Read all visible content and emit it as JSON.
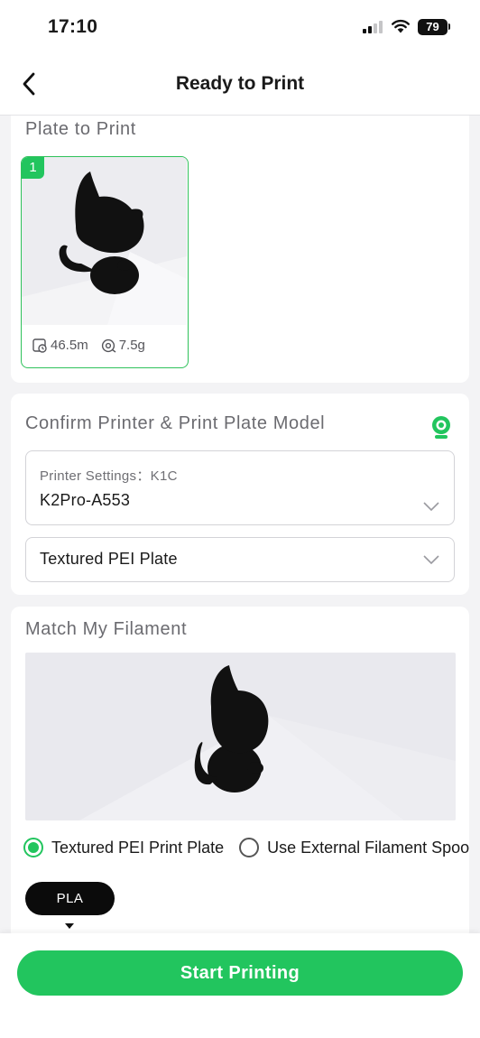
{
  "status_bar": {
    "time": "17:10",
    "battery": "79",
    "signal_bars": 2
  },
  "nav": {
    "title": "Ready to Print",
    "back_icon": "chevron-left-icon"
  },
  "plate_section": {
    "title": "Plate to Print",
    "plates": [
      {
        "number": "1",
        "length": "46.5m",
        "weight": "7.5g",
        "selected": true
      }
    ]
  },
  "printer_section": {
    "title": "Confirm Printer & Print Plate Model",
    "webcam_icon": "webcam-icon",
    "printer_caption": "Printer Settings：K1C",
    "printer_value": "K2Pro-A553",
    "plate_value": "Textured PEI Plate"
  },
  "filament_section": {
    "title": "Match My Filament",
    "options": [
      {
        "label": "Textured PEI Print Plate",
        "selected": true
      },
      {
        "label": "Use External Filament Spool",
        "selected": false
      }
    ],
    "filament_chip": "PLA"
  },
  "footer": {
    "start_label": "Start Printing"
  },
  "colors": {
    "accent": "#22c55e",
    "chip_bg": "#0b0b0b"
  }
}
